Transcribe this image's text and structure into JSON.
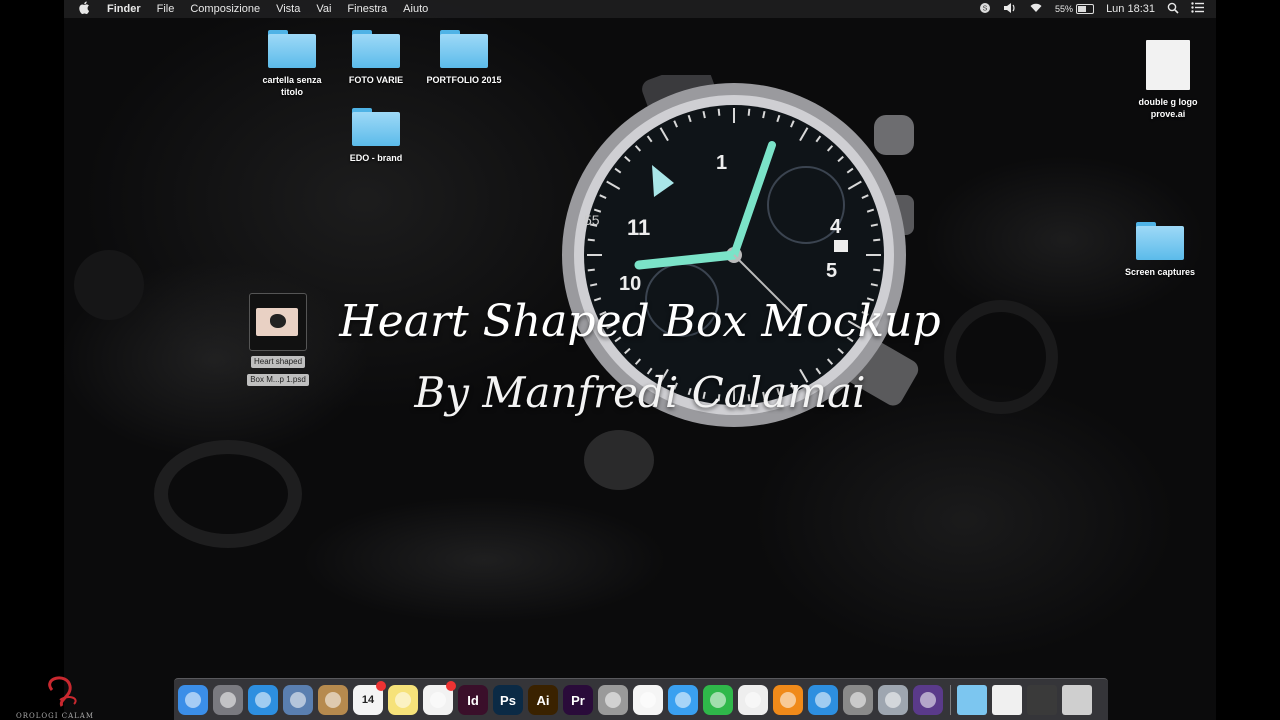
{
  "menubar": {
    "app_name": "Finder",
    "menus": [
      "File",
      "Composizione",
      "Vista",
      "Vai",
      "Finestra",
      "Aiuto"
    ],
    "battery_percent": "55%",
    "battery_level": 0.55,
    "clock": "Lun 18:31"
  },
  "desktop": {
    "folders": [
      {
        "label": "cartella senza titolo"
      },
      {
        "label": "FOTO VARIE"
      },
      {
        "label": "PORTFOLIO 2015"
      },
      {
        "label": "EDO - brand"
      },
      {
        "label": "Screen captures"
      }
    ],
    "doc_file": {
      "label": "double g logo prove.ai"
    },
    "psd_file": {
      "label_line1": "Heart shaped",
      "label_line2": "Box M...p 1.psd"
    }
  },
  "overlay": {
    "title": "Heart Shaped Box Mockup",
    "subtitle": "By Manfredi Calamai"
  },
  "watch_dial": {
    "numerals": [
      "1",
      "11",
      "4",
      "5",
      "10",
      "55"
    ]
  },
  "dock": {
    "apps": [
      {
        "name": "finder-icon",
        "glyph": "",
        "color": "#3b8ee8"
      },
      {
        "name": "launchpad-icon",
        "glyph": "",
        "color": "#7a7a80"
      },
      {
        "name": "safari-icon",
        "glyph": "",
        "color": "#2d8fe0"
      },
      {
        "name": "preview-icon",
        "glyph": "",
        "color": "#5a7fb0"
      },
      {
        "name": "contacts-icon",
        "glyph": "",
        "color": "#b68a4e"
      },
      {
        "name": "calendar-icon",
        "glyph": "14",
        "color": "#f4f4f4"
      },
      {
        "name": "notes-icon",
        "glyph": "",
        "color": "#f6e27a"
      },
      {
        "name": "reminders-icon",
        "glyph": "",
        "color": "#f2f2f2"
      },
      {
        "name": "indesign-icon",
        "glyph": "Id",
        "color": "#3a0f2a"
      },
      {
        "name": "photoshop-icon",
        "glyph": "Ps",
        "color": "#0b2a45"
      },
      {
        "name": "illustrator-icon",
        "glyph": "Ai",
        "color": "#3a2200"
      },
      {
        "name": "premiere-icon",
        "glyph": "Pr",
        "color": "#2a0b3a"
      },
      {
        "name": "photo-booth-icon",
        "glyph": "",
        "color": "#9a9a9a"
      },
      {
        "name": "photos-icon",
        "glyph": "",
        "color": "#f5f5f5"
      },
      {
        "name": "messages-icon",
        "glyph": "",
        "color": "#3aa0f0"
      },
      {
        "name": "facetime-icon",
        "glyph": "",
        "color": "#2fb84a"
      },
      {
        "name": "itunes-icon",
        "glyph": "",
        "color": "#eeeeee"
      },
      {
        "name": "ibooks-icon",
        "glyph": "",
        "color": "#f08a1a"
      },
      {
        "name": "app-store-icon",
        "glyph": "",
        "color": "#2d8fe0"
      },
      {
        "name": "system-preferences-icon",
        "glyph": "",
        "color": "#8a8a8a"
      },
      {
        "name": "preview-utility-icon",
        "glyph": "",
        "color": "#9ea6b0"
      },
      {
        "name": "purple-app-icon",
        "glyph": "",
        "color": "#5a3a8a"
      }
    ],
    "right_items": [
      {
        "name": "applications-folder-icon",
        "color": "#7cc6f0"
      },
      {
        "name": "document-stack-icon",
        "color": "#f0f0f0"
      },
      {
        "name": "downloads-stack-icon",
        "color": "#3a3a3a"
      },
      {
        "name": "trash-icon",
        "color": "#cfcfcf"
      }
    ]
  },
  "brand": {
    "text": "OROLOGI CALAM"
  }
}
